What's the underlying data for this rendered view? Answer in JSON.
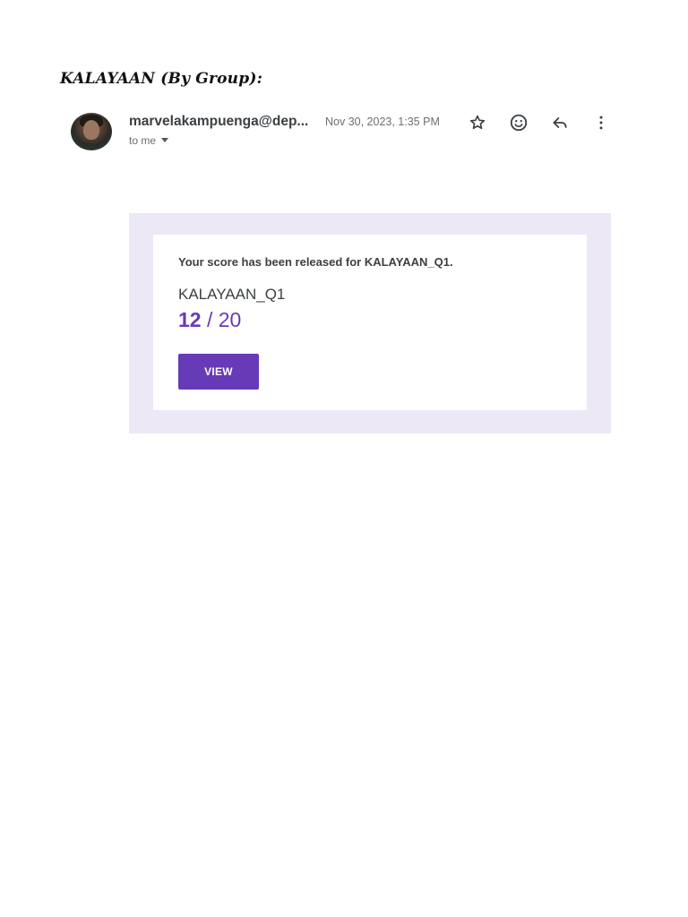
{
  "document": {
    "heading": "KALAYAAN (By Group):"
  },
  "email": {
    "sender": "marvelakampuenga@dep...",
    "recipient_label": "to me",
    "date": "Nov 30, 2023, 1:35 PM",
    "actions": [
      {
        "name": "star-icon"
      },
      {
        "name": "emoji-icon"
      },
      {
        "name": "reply-icon"
      },
      {
        "name": "more-icon"
      }
    ]
  },
  "card": {
    "released_text": "Your score has been released for KALAYAAN_Q1.",
    "quiz_name": "KALAYAAN_Q1",
    "score": "12",
    "score_separator": " / ",
    "total": "20",
    "view_label": "VIEW"
  },
  "colors": {
    "accent": "#673ab7",
    "card_background": "#ece8f5"
  }
}
